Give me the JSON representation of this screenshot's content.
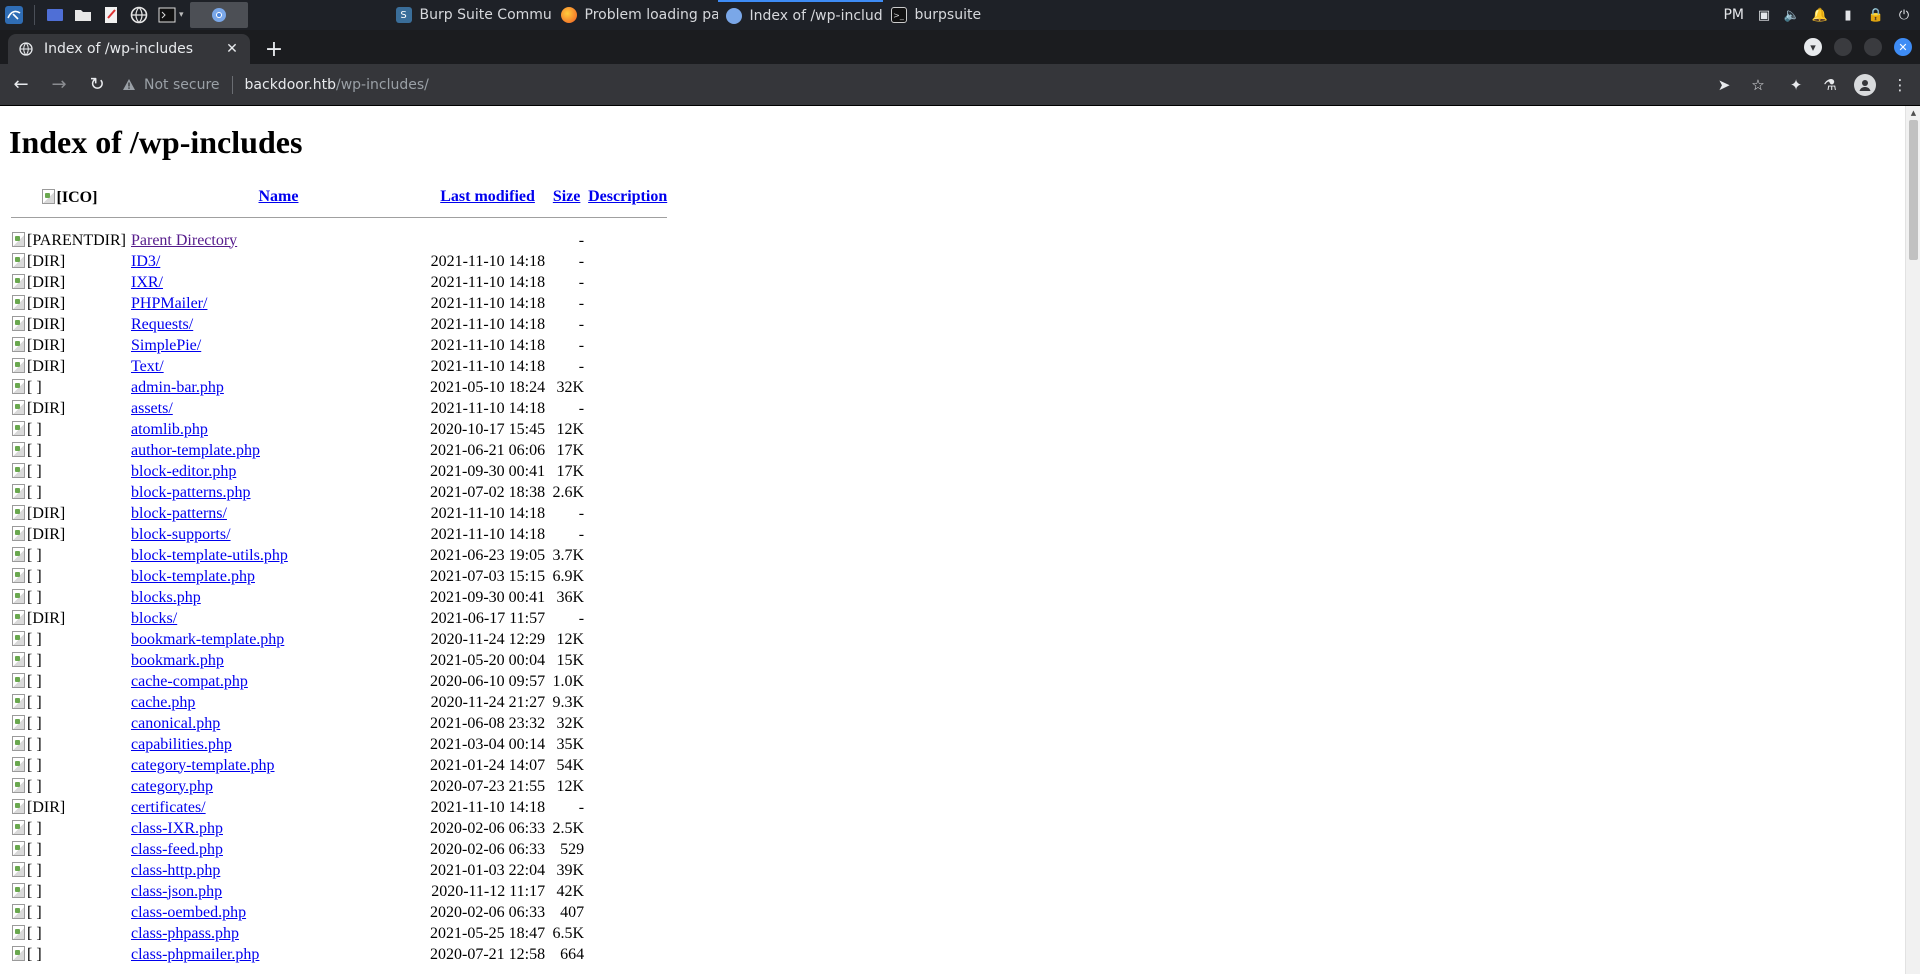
{
  "taskbar": {
    "tasks": [
      {
        "label": "",
        "icon": "chromium-icon",
        "active": false
      },
      {
        "label": "Burp Suite Community E",
        "icon": "burp-icon",
        "active": false
      },
      {
        "label": "Problem loading page",
        "icon": "firefox-icon",
        "active": false
      },
      {
        "label": "Index of /wp-includes",
        "icon": "chromium-icon",
        "active": true
      },
      {
        "label": "burpsuite",
        "icon": "terminal-icon",
        "active": false
      }
    ],
    "clock": "PM"
  },
  "browser": {
    "tab_title": "Index of /wp-includes",
    "security_label": "Not secure",
    "url_host": "backdoor.htb",
    "url_path": "/wp-includes/"
  },
  "page": {
    "heading": "Index of /wp-includes",
    "columns": {
      "icon": "[ICO]",
      "name": "Name",
      "modified": "Last modified",
      "size": "Size",
      "description": "Description"
    },
    "rows": [
      {
        "alt": "[PARENTDIR]",
        "name": "Parent Directory",
        "modified": "",
        "size": "-",
        "visited": true
      },
      {
        "alt": "[DIR]",
        "name": "ID3/",
        "modified": "2021-11-10 14:18",
        "size": "-"
      },
      {
        "alt": "[DIR]",
        "name": "IXR/",
        "modified": "2021-11-10 14:18",
        "size": "-"
      },
      {
        "alt": "[DIR]",
        "name": "PHPMailer/",
        "modified": "2021-11-10 14:18",
        "size": "-"
      },
      {
        "alt": "[DIR]",
        "name": "Requests/",
        "modified": "2021-11-10 14:18",
        "size": "-"
      },
      {
        "alt": "[DIR]",
        "name": "SimplePie/",
        "modified": "2021-11-10 14:18",
        "size": "-"
      },
      {
        "alt": "[DIR]",
        "name": "Text/",
        "modified": "2021-11-10 14:18",
        "size": "-"
      },
      {
        "alt": "[ ]",
        "name": "admin-bar.php",
        "modified": "2021-05-10 18:24",
        "size": "32K"
      },
      {
        "alt": "[DIR]",
        "name": "assets/",
        "modified": "2021-11-10 14:18",
        "size": "-"
      },
      {
        "alt": "[ ]",
        "name": "atomlib.php",
        "modified": "2020-10-17 15:45",
        "size": "12K"
      },
      {
        "alt": "[ ]",
        "name": "author-template.php",
        "modified": "2021-06-21 06:06",
        "size": "17K"
      },
      {
        "alt": "[ ]",
        "name": "block-editor.php",
        "modified": "2021-09-30 00:41",
        "size": "17K"
      },
      {
        "alt": "[ ]",
        "name": "block-patterns.php",
        "modified": "2021-07-02 18:38",
        "size": "2.6K"
      },
      {
        "alt": "[DIR]",
        "name": "block-patterns/",
        "modified": "2021-11-10 14:18",
        "size": "-"
      },
      {
        "alt": "[DIR]",
        "name": "block-supports/",
        "modified": "2021-11-10 14:18",
        "size": "-"
      },
      {
        "alt": "[ ]",
        "name": "block-template-utils.php",
        "modified": "2021-06-23 19:05",
        "size": "3.7K"
      },
      {
        "alt": "[ ]",
        "name": "block-template.php",
        "modified": "2021-07-03 15:15",
        "size": "6.9K"
      },
      {
        "alt": "[ ]",
        "name": "blocks.php",
        "modified": "2021-09-30 00:41",
        "size": "36K"
      },
      {
        "alt": "[DIR]",
        "name": "blocks/",
        "modified": "2021-06-17 11:57",
        "size": "-"
      },
      {
        "alt": "[ ]",
        "name": "bookmark-template.php",
        "modified": "2020-11-24 12:29",
        "size": "12K"
      },
      {
        "alt": "[ ]",
        "name": "bookmark.php",
        "modified": "2021-05-20 00:04",
        "size": "15K"
      },
      {
        "alt": "[ ]",
        "name": "cache-compat.php",
        "modified": "2020-06-10 09:57",
        "size": "1.0K"
      },
      {
        "alt": "[ ]",
        "name": "cache.php",
        "modified": "2020-11-24 21:27",
        "size": "9.3K"
      },
      {
        "alt": "[ ]",
        "name": "canonical.php",
        "modified": "2021-06-08 23:32",
        "size": "32K"
      },
      {
        "alt": "[ ]",
        "name": "capabilities.php",
        "modified": "2021-03-04 00:14",
        "size": "35K"
      },
      {
        "alt": "[ ]",
        "name": "category-template.php",
        "modified": "2021-01-24 14:07",
        "size": "54K"
      },
      {
        "alt": "[ ]",
        "name": "category.php",
        "modified": "2020-07-23 21:55",
        "size": "12K"
      },
      {
        "alt": "[DIR]",
        "name": "certificates/",
        "modified": "2021-11-10 14:18",
        "size": "-"
      },
      {
        "alt": "[ ]",
        "name": "class-IXR.php",
        "modified": "2020-02-06 06:33",
        "size": "2.5K"
      },
      {
        "alt": "[ ]",
        "name": "class-feed.php",
        "modified": "2020-02-06 06:33",
        "size": "529"
      },
      {
        "alt": "[ ]",
        "name": "class-http.php",
        "modified": "2021-01-03 22:04",
        "size": "39K"
      },
      {
        "alt": "[ ]",
        "name": "class-json.php",
        "modified": "2020-11-12 11:17",
        "size": "42K"
      },
      {
        "alt": "[ ]",
        "name": "class-oembed.php",
        "modified": "2020-02-06 06:33",
        "size": "407"
      },
      {
        "alt": "[ ]",
        "name": "class-phpass.php",
        "modified": "2021-05-25 18:47",
        "size": "6.5K"
      },
      {
        "alt": "[ ]",
        "name": "class-phpmailer.php",
        "modified": "2020-07-21 12:58",
        "size": "664"
      }
    ]
  }
}
